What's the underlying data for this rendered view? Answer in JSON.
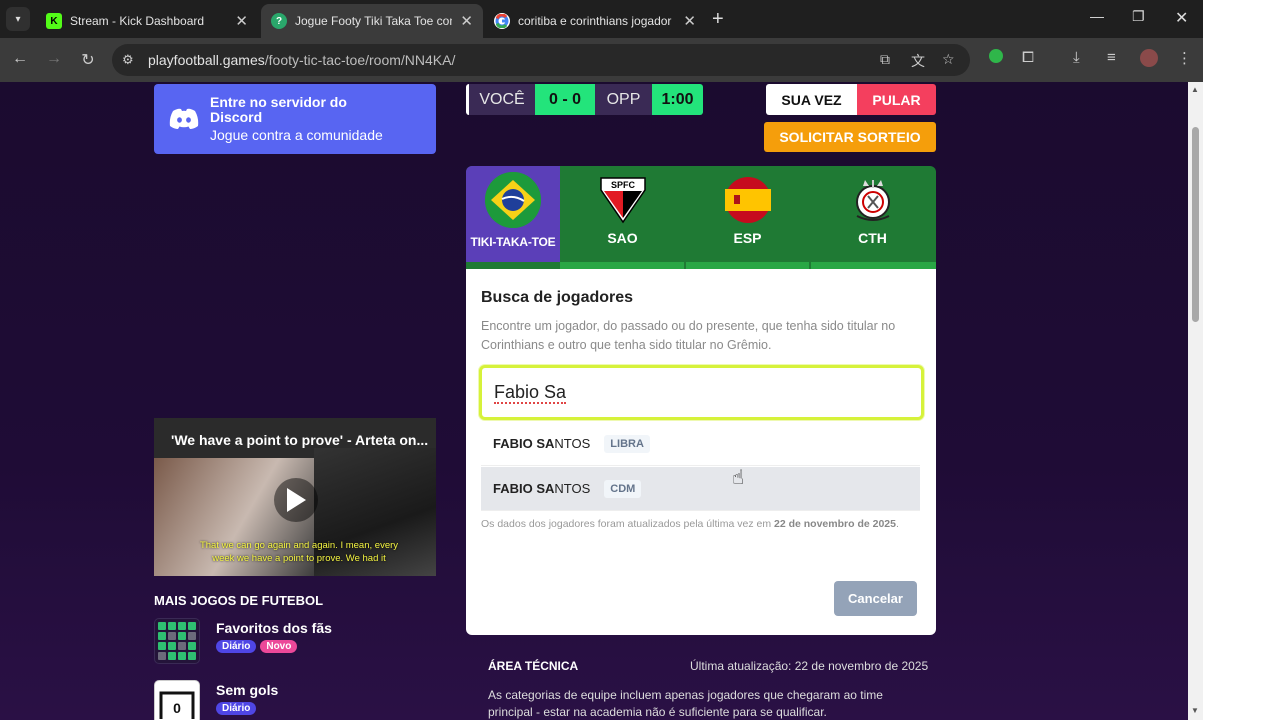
{
  "browser": {
    "tabs": [
      {
        "title": "Stream - Kick Dashboard",
        "icon": "kick-icon",
        "active": false
      },
      {
        "title": "Jogue Footy Tiki Taka Toe contra",
        "icon": "help-icon",
        "active": true
      },
      {
        "title": "coritiba e corinthians jogador - P",
        "icon": "google-icon",
        "active": false
      }
    ],
    "url_host": "playfootball.games",
    "url_path": "/footy-tic-tac-toe/room/NN4KA/"
  },
  "discord": {
    "title": "Entre no servidor do Discord",
    "subtitle": "Jogue contra a comunidade",
    "color": "#5865f2"
  },
  "score": {
    "you_label": "VOCÊ",
    "score": "0 - 0",
    "opp_label": "OPP",
    "timer": "1:00"
  },
  "turn": {
    "your_turn": "SUA VEZ",
    "skip": "PULAR",
    "request_draw": "SOLICITAR SORTEIO"
  },
  "board": {
    "logo_label": "TIKI-TAKA-TOE",
    "teams": [
      {
        "code": "SAO",
        "crest": "sao-paulo-crest-icon"
      },
      {
        "code": "ESP",
        "crest": "spain-flag-icon"
      },
      {
        "code": "CTH",
        "crest": "corinthians-crest-icon"
      }
    ]
  },
  "modal": {
    "title": "Busca de jogadores",
    "description": "Encontre um jogador, do passado ou do presente, que tenha sido titular no Corinthians e outro que tenha sido titular no Grêmio.",
    "search_value": "Fabio Sa",
    "suggestions": [
      {
        "match": "FABIO SA",
        "rest": "NTOS",
        "position": "LIBRA"
      },
      {
        "match": "FABIO SA",
        "rest": "NTOS",
        "position": "CDM"
      }
    ],
    "note_prefix": "Os dados dos jogadores foram atualizados pela última vez em ",
    "note_date": "22 de novembro de 2025",
    "note_suffix": ".",
    "cancel": "Cancelar"
  },
  "video": {
    "title": "'We have a point to prove' - Arteta on...",
    "caption": "That we can go again and again. I mean, every week we have a point to prove. We had it"
  },
  "more_games": {
    "heading": "MAIS JOGOS DE FUTEBOL",
    "games": [
      {
        "name": "Favoritos dos fãs",
        "badges": [
          "Diário",
          "Novo"
        ]
      },
      {
        "name": "Sem gols",
        "badges": [
          "Diário"
        ],
        "icon_text": "0"
      }
    ]
  },
  "tech": {
    "heading": "ÁREA TÉCNICA",
    "updated": "Última atualização: 22 de novembro de 2025",
    "text": "As categorias de equipe incluem apenas jogadores que chegaram ao time principal - estar na academia não é suficiente para se qualificar."
  }
}
